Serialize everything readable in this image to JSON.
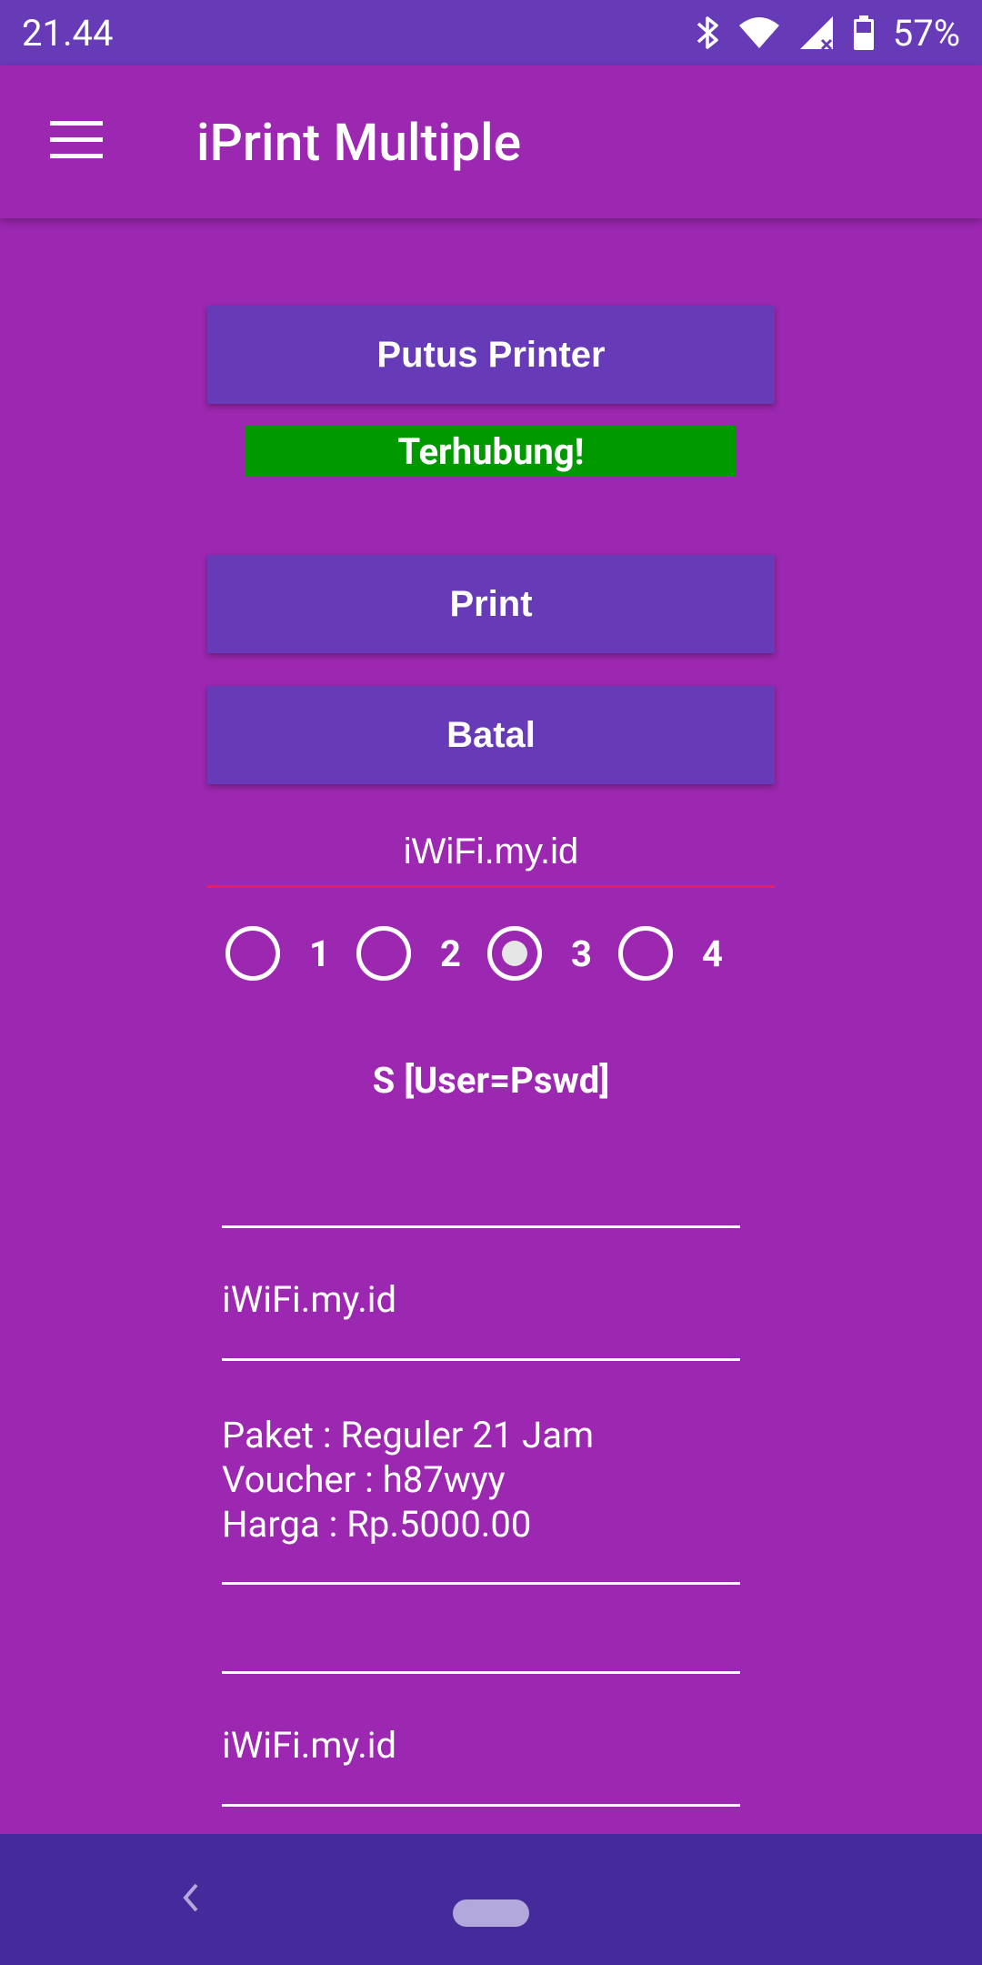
{
  "status_bar": {
    "time": "21.44",
    "battery": "57%",
    "icons": [
      "bluetooth-icon",
      "wifi-icon",
      "signal-icon",
      "battery-icon"
    ]
  },
  "app_bar": {
    "title": "iPrint Multiple",
    "menu_icon": "hamburger-menu-icon"
  },
  "actions": {
    "disconnect_label": "Putus Printer",
    "connection_status": "Terhubung!",
    "print_label": "Print",
    "cancel_label": "Batal"
  },
  "header_input": {
    "value": "iWiFi.my.id"
  },
  "radio_options": {
    "items": [
      "1",
      "2",
      "3",
      "4"
    ],
    "selected": "3"
  },
  "section": {
    "title": "S [User=Pswd]"
  },
  "voucher_fields": {
    "field1": "",
    "field2": "iWiFi.my.id",
    "field3_line1": "Paket : Reguler 21 Jam",
    "field3_line2": "Voucher : h87wyy",
    "field3_line3": "Harga : Rp.5000.00",
    "field4": "",
    "field5": "iWiFi.my.id"
  },
  "colors": {
    "background": "#9c27b0",
    "status_bar": "#673ab7",
    "button": "#673ab7",
    "connected": "#009900",
    "underline_accent": "#e91e63",
    "nav_bar": "#452a9b"
  }
}
